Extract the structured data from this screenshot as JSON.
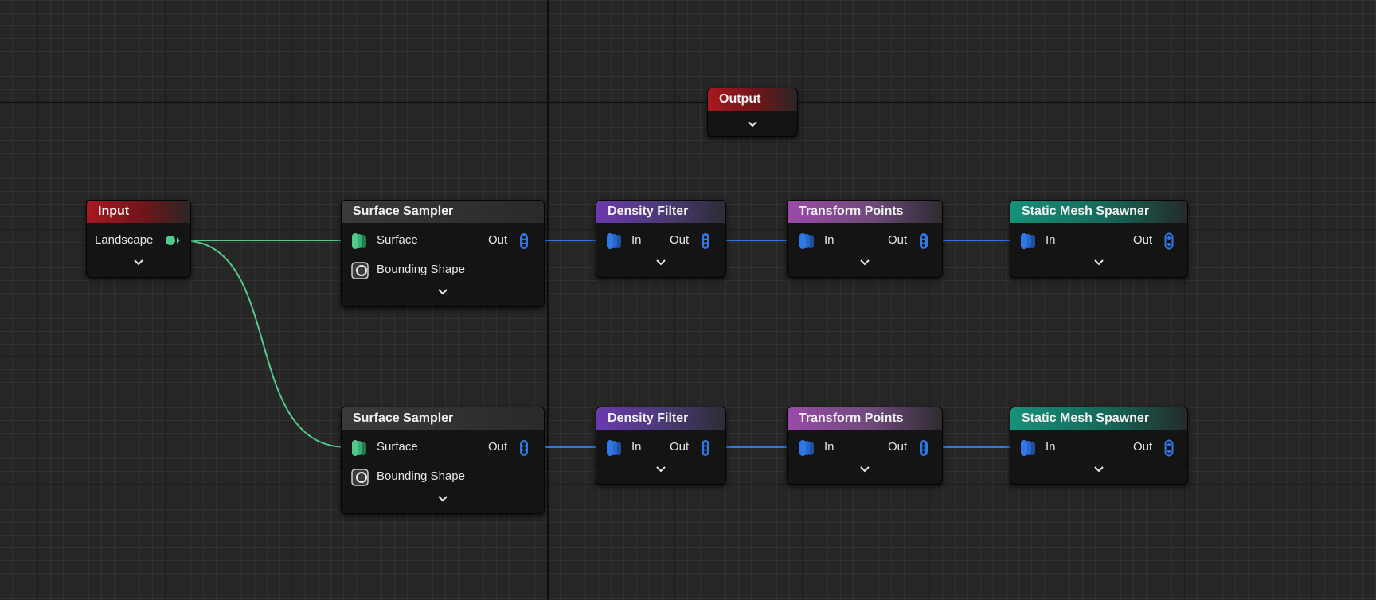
{
  "graph": {
    "output_node": {
      "title": "Output"
    },
    "input_node": {
      "title": "Input",
      "pin_landscape": "Landscape"
    },
    "upper_chain": {
      "sampler": {
        "title": "Surface Sampler",
        "pin_surface": "Surface",
        "pin_bounding": "Bounding Shape",
        "pin_out": "Out"
      },
      "density": {
        "title": "Density Filter",
        "pin_in": "In",
        "pin_out": "Out"
      },
      "transform": {
        "title": "Transform Points",
        "pin_in": "In",
        "pin_out": "Out"
      },
      "spawner": {
        "title": "Static Mesh Spawner",
        "pin_in": "In",
        "pin_out": "Out"
      }
    },
    "lower_chain": {
      "sampler": {
        "title": "Surface Sampler",
        "pin_surface": "Surface",
        "pin_bounding": "Bounding Shape",
        "pin_out": "Out"
      },
      "density": {
        "title": "Density Filter",
        "pin_in": "In",
        "pin_out": "Out"
      },
      "transform": {
        "title": "Transform Points",
        "pin_in": "In",
        "pin_out": "Out"
      },
      "spawner": {
        "title": "Static Mesh Spawner",
        "pin_in": "In",
        "pin_out": "Out"
      }
    }
  },
  "colors": {
    "grid_background": "#262626",
    "wire_green": "#52c98a",
    "wire_blue": "#2f78e8",
    "header_red": "#a8181f",
    "header_purple": "#6a3aad",
    "header_pink": "#9a4aa8",
    "header_teal": "#16917a"
  },
  "icons": {
    "point_data_in": "stacked-points-blue-icon",
    "point_data_out": "blue-point-out-icon",
    "surface": "stacked-surface-green-icon",
    "bounding_shape": "bounding-shape-icon",
    "landscape_out": "green-dot-arrow-icon",
    "expand": "chevron-down-icon"
  }
}
